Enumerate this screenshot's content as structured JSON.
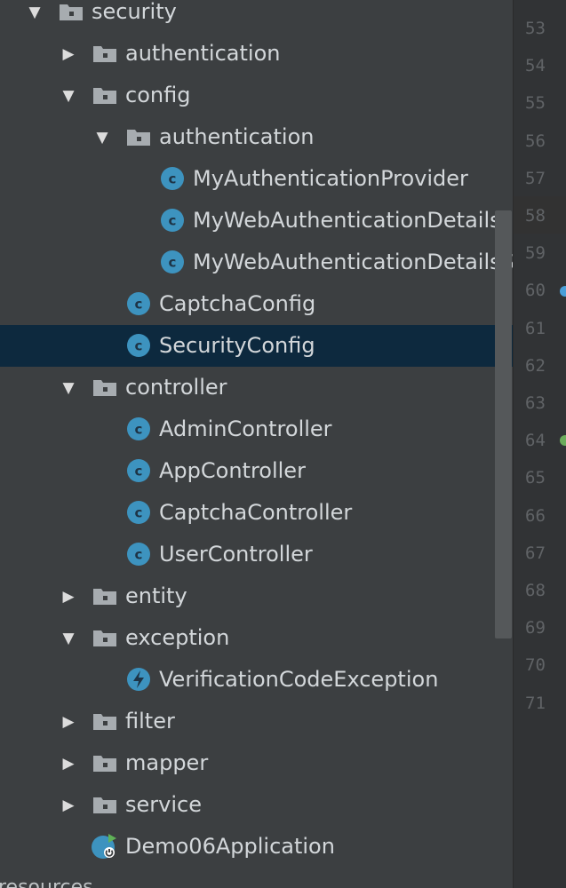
{
  "project_tree": {
    "rows": [
      {
        "type": "folder",
        "label": "security",
        "expanded": true
      },
      {
        "type": "folder",
        "label": "authentication",
        "expanded": false
      },
      {
        "type": "folder",
        "label": "config",
        "expanded": true
      },
      {
        "type": "folder",
        "label": "authentication",
        "expanded": true
      },
      {
        "type": "class",
        "label": "MyAuthenticationProvider"
      },
      {
        "type": "class",
        "label": "MyWebAuthenticationDetails"
      },
      {
        "type": "class",
        "label": "MyWebAuthenticationDetailsSource"
      },
      {
        "type": "class",
        "label": "CaptchaConfig"
      },
      {
        "type": "class",
        "label": "SecurityConfig",
        "selected": true
      },
      {
        "type": "folder",
        "label": "controller",
        "expanded": true
      },
      {
        "type": "class",
        "label": "AdminController"
      },
      {
        "type": "class",
        "label": "AppController"
      },
      {
        "type": "class",
        "label": "CaptchaController"
      },
      {
        "type": "class",
        "label": "UserController"
      },
      {
        "type": "folder",
        "label": "entity",
        "expanded": false
      },
      {
        "type": "folder",
        "label": "exception",
        "expanded": true
      },
      {
        "type": "exception",
        "label": "VerificationCodeException"
      },
      {
        "type": "folder",
        "label": "filter",
        "expanded": false
      },
      {
        "type": "folder",
        "label": "mapper",
        "expanded": false
      },
      {
        "type": "folder",
        "label": "service",
        "expanded": false
      },
      {
        "type": "app",
        "label": "Demo06Application"
      }
    ],
    "cutoff_label": "resources"
  },
  "editor_gutter": {
    "line_numbers": [
      "53",
      "54",
      "55",
      "56",
      "57",
      "58",
      "59",
      "60",
      "61",
      "62",
      "63",
      "64",
      "65",
      "66",
      "67",
      "68",
      "69",
      "70",
      "71"
    ],
    "current_line": "58"
  },
  "colors": {
    "tree_background": "#3c3f41",
    "selection": "#0d293e",
    "folder_icon": "#a7acb0",
    "class_icon": "#3d93bf",
    "gutter_background": "#313335"
  }
}
